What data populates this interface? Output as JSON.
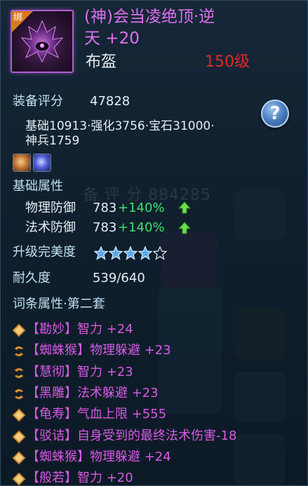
{
  "item": {
    "bind_badge": "绑",
    "name_line1": "(神)会当凌绝顶·逆",
    "name_line2": "天 +20",
    "type": "布盔",
    "level": "150级"
  },
  "score": {
    "label": "装备评分",
    "value": "47828",
    "breakdown_line1": "基础10913·强化3756·宝石31000·",
    "breakdown_line2": "神兵1759"
  },
  "background_score": "备 评 分  884285",
  "base_attrs": {
    "title": "基础属性",
    "rows": [
      {
        "name": "物理防御",
        "value": "783",
        "bonus": "+140%"
      },
      {
        "name": "法术防御",
        "value": "783",
        "bonus": "+140%"
      }
    ]
  },
  "upgrade": {
    "label": "升级完美度",
    "stars_filled": 4,
    "stars_total": 5
  },
  "durability": {
    "label": "耐久度",
    "value": "539/640"
  },
  "affixes": {
    "title": "词条属性·第二套",
    "rows": [
      {
        "icon": "diamond-icon",
        "tag": "【勘妙】",
        "effect": "智力 +24"
      },
      {
        "icon": "swirl-icon",
        "tag": "【蜘蛛猴】",
        "effect": "物理躲避 +23"
      },
      {
        "icon": "swirl-icon",
        "tag": "【慧彻】",
        "effect": "智力 +23"
      },
      {
        "icon": "swirl-icon",
        "tag": "【黑雕】",
        "effect": "法术躲避 +23"
      },
      {
        "icon": "diamond-icon",
        "tag": "【龟寿】",
        "effect": "气血上限 +555"
      },
      {
        "icon": "diamond-icon",
        "tag": "【驳诘】",
        "effect": "自身受到的最终法术伤害-18"
      },
      {
        "icon": "diamond-icon",
        "tag": "【蜘蛛猴】",
        "effect": "物理躲避 +24"
      },
      {
        "icon": "diamond-icon",
        "tag": "【般若】",
        "effect": "智力 +20"
      }
    ]
  },
  "colors": {
    "title": "#e070f0",
    "level": "#e02828",
    "label": "#bfe1f2",
    "bonus": "#3ee070",
    "affix": "#d65ae6"
  }
}
